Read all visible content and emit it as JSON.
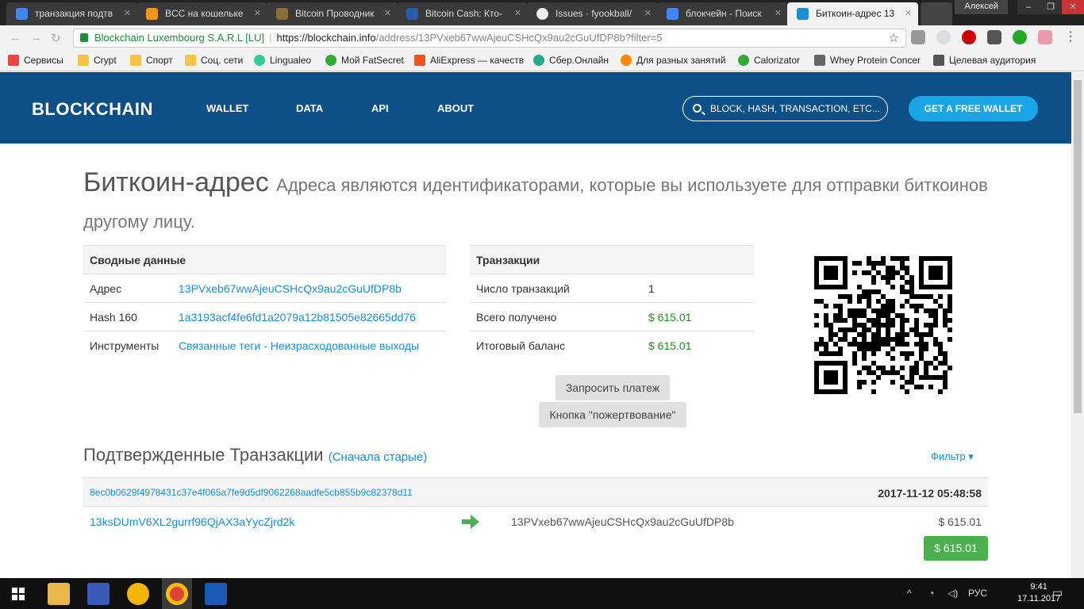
{
  "browser": {
    "tabs": [
      {
        "title": "транзакция подтв",
        "color": "#4285f4"
      },
      {
        "title": "BCC на кошельке",
        "color": "#f7931a"
      },
      {
        "title": "Bitcoin Проводник",
        "color": "#8a6d3b"
      },
      {
        "title": "Bitcoin Cash: Кто-",
        "color": "#2a5caa"
      },
      {
        "title": "Issues · fyookball/",
        "color": "#222222"
      },
      {
        "title": "блокчейн - Поиск",
        "color": "#4285f4"
      },
      {
        "title": "Биткоин-адрес 13",
        "color": "#1a8fd1"
      }
    ],
    "user": "Алексей",
    "omnibox": {
      "site_label": "Blockchain Luxembourg S.A.R.L [LU]",
      "host": "https://blockchain.info",
      "path": "/address/13PVxeb67wwAjeuCSHcQx9au2cGuUfDP8b?filter=5"
    },
    "bookmarks": [
      {
        "label": "Сервисы",
        "color": "#e44"
      },
      {
        "label": "Crypt",
        "color": "#f4c542"
      },
      {
        "label": "Спорт",
        "color": "#f4c542"
      },
      {
        "label": "Соц. сети",
        "color": "#f4c542"
      },
      {
        "label": "Lingualeo",
        "color": "#3c9"
      },
      {
        "label": "Мой FatSecret",
        "color": "#3a3"
      },
      {
        "label": "AliExpress — качеств",
        "color": "#e52"
      },
      {
        "label": "Сбер.Онлайн",
        "color": "#2a8"
      },
      {
        "label": "Для разных занятий",
        "color": "#f80"
      },
      {
        "label": "Calorizator",
        "color": "#3a3"
      },
      {
        "label": "Whey Protein Concer",
        "color": "#666"
      },
      {
        "label": "Целевая аудитория",
        "color": "#555"
      }
    ]
  },
  "site": {
    "logo": "BLOCKCHAIN",
    "nav": [
      "WALLET",
      "DATA",
      "API",
      "ABOUT"
    ],
    "search_placeholder": "BLOCK, HASH, TRANSACTION, ETC...",
    "cta": "GET A FREE WALLET"
  },
  "page": {
    "title": "Биткоин-адрес",
    "subtitle": "Адреса являются идентификаторами, которые вы используете для отправки биткоинов другому лицу.",
    "summary": {
      "header": "Сводные данные",
      "rows": [
        {
          "label": "Адрес",
          "value": "13PVxeb67wwAjeuCSHcQx9au2cGuUfDP8b"
        },
        {
          "label": "Hash 160",
          "value": "1a3193acf4fe6fd1a2079a12b81505e82665dd76"
        },
        {
          "label": "Инструменты",
          "value": "Связанные теги - Неизрасходованные выходы"
        }
      ]
    },
    "transactions": {
      "header": "Транзакции",
      "rows": [
        {
          "label": "Число транзакций",
          "value": "1"
        },
        {
          "label": "Всего получено",
          "value": "$ 615.01"
        },
        {
          "label": "Итоговый баланс",
          "value": "$ 615.01"
        }
      ]
    },
    "request_payment": "Запросить платеж",
    "donate_button": "Кнопка \"пожертвование\"",
    "confirmed": {
      "title": "Подтвержденные Транзакции",
      "order": "(Сначала старые)",
      "filter": "Фильтр ▾",
      "tx": {
        "hash": "8ec0b0629f4978431c37e4f065a7fe9d5df9062268aadfe5cb855b9c82378d11",
        "date": "2017-11-12 05:48:58",
        "from": "13ksDUmV6XL2gurrf96QjAX3aYycZjrd2k",
        "to": "13PVxeb67wwAjeuCSHcQx9au2cGuUfDP8b",
        "amount": "$ 615.01",
        "total": "$ 615.01"
      }
    }
  },
  "taskbar": {
    "lang": "РУС",
    "time": "9:41",
    "date": "17.11.2017"
  }
}
